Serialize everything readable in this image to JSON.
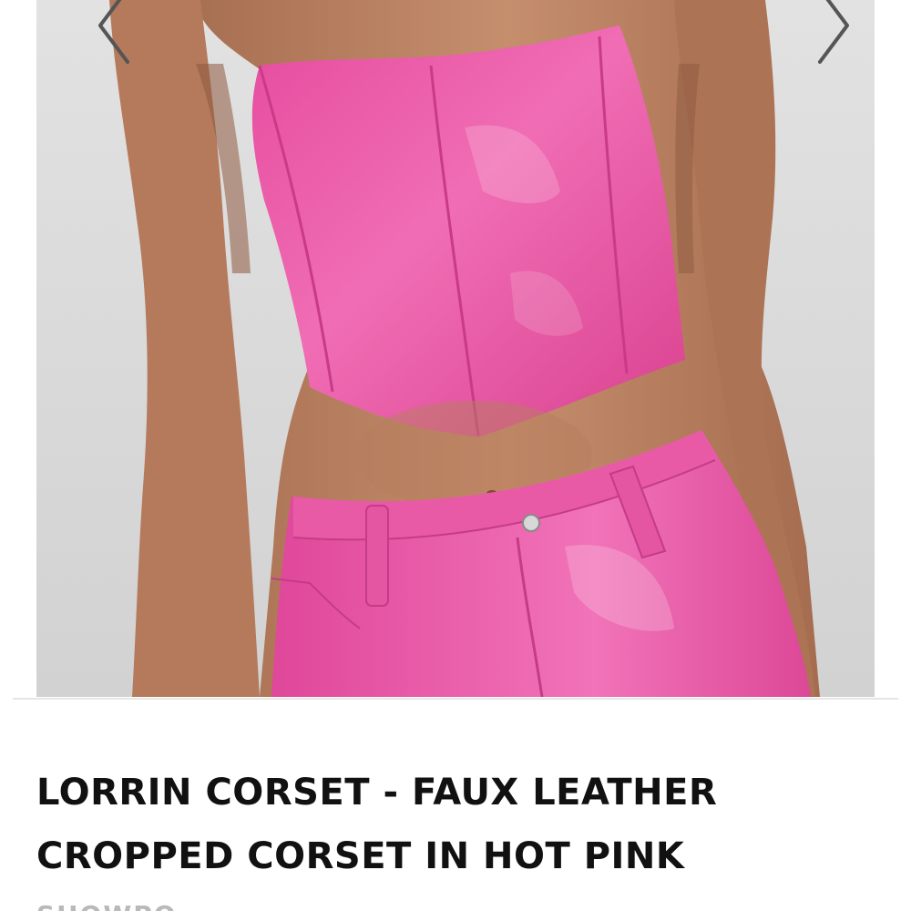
{
  "gallery": {
    "image_alt": "Model wearing hot pink faux leather strapless corset and matching pants",
    "prev_icon": "chevron-left-icon",
    "next_icon": "chevron-right-icon"
  },
  "colors": {
    "product_pink": "#ec5aa8",
    "background_gray": "#dcdcdc",
    "title_text": "#111111",
    "brand_text": "#b9b9b9"
  },
  "product": {
    "title": "LORRIN CORSET - FAUX LEATHER CROPPED CORSET IN HOT PINK",
    "brand": "SHOWPO"
  }
}
